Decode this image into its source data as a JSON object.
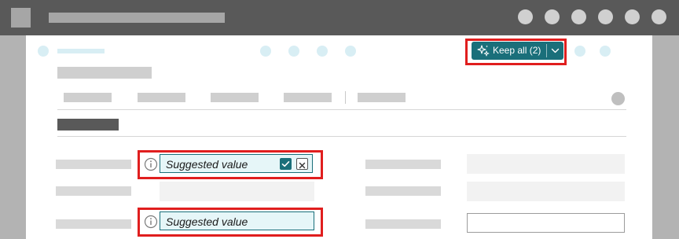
{
  "toolbar": {
    "keep_all_label": "Keep all (2)"
  },
  "form": {
    "suggestion_1_value": "Suggested value",
    "suggestion_2_value": "Suggested value"
  },
  "colors": {
    "accent": "#1a6f7a",
    "highlight": "#e01e1e",
    "suggestion_bg": "#e6f6f8"
  },
  "icons": [
    "sparkle-icon",
    "chevron-down-icon",
    "info-icon",
    "checkmark-icon",
    "close-icon"
  ]
}
